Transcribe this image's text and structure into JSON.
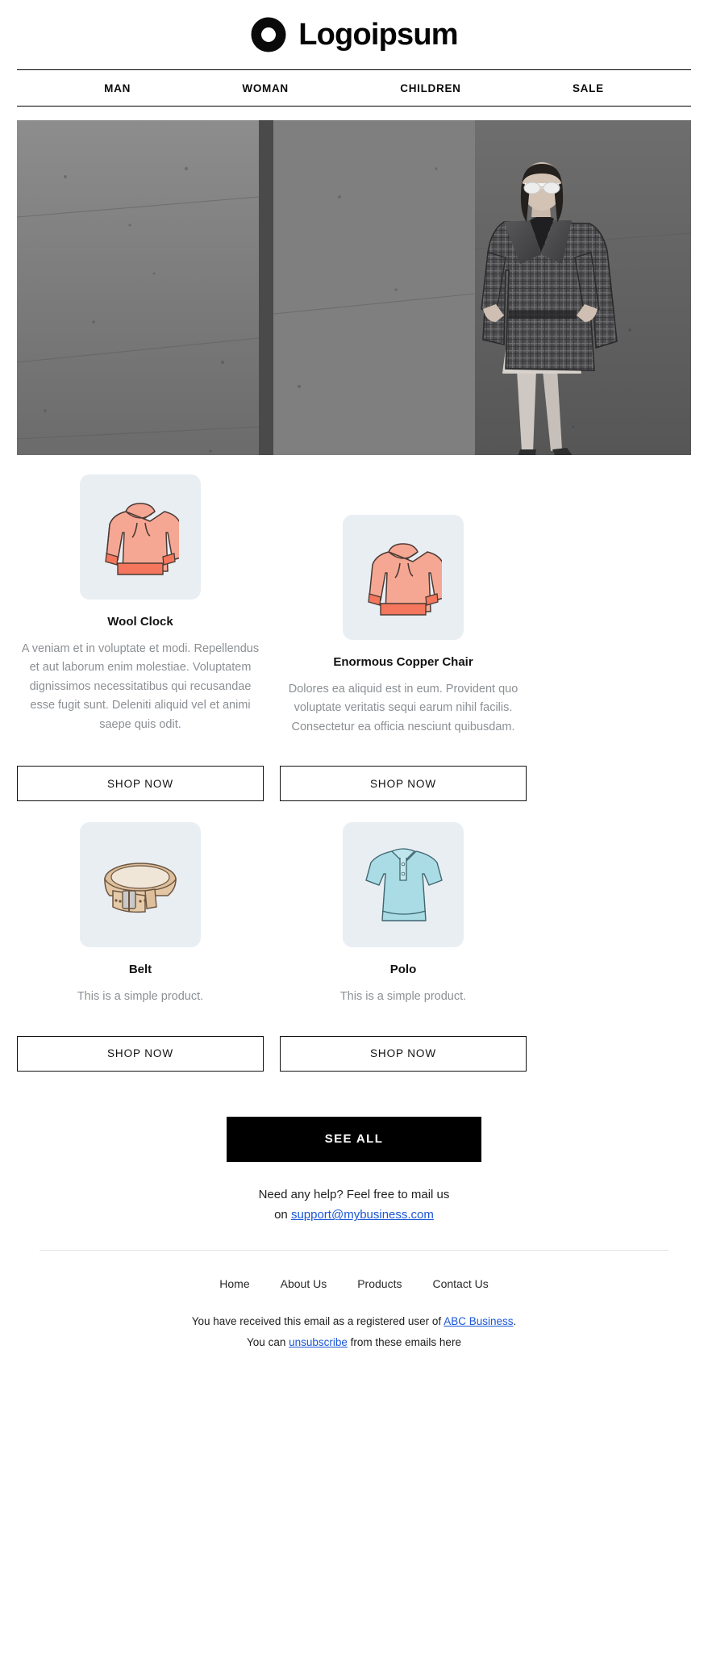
{
  "brand": {
    "name": "Logoipsum",
    "logo_icon": "logoipsum-circle-mark"
  },
  "nav": {
    "items": [
      {
        "label": "MAN"
      },
      {
        "label": "WOMAN"
      },
      {
        "label": "CHILDREN"
      },
      {
        "label": "SALE"
      }
    ]
  },
  "hero": {
    "alt": "woman-in-plaid-coat-black-and-white-photo"
  },
  "products": [
    {
      "title": "Wool Clock",
      "description": "A veniam et in voluptate et modi. Repellendus et aut laborum enim molestiae. Voluptatem dignissimos necessitatibus qui recusandae esse fugit sunt. Deleniti aliquid vel et animi saepe quis odit.",
      "button": "SHOP NOW",
      "image_icon": "pink-hoodie-illustration"
    },
    {
      "title": "Enormous Copper Chair",
      "description": "Dolores ea aliquid est in eum. Provident quo voluptate veritatis sequi earum nihil facilis. Consectetur ea officia nesciunt quibusdam.",
      "button": "SHOP NOW",
      "image_icon": "pink-hoodie-illustration"
    },
    {
      "title": "Belt",
      "description": "This is a simple product.",
      "button": "SHOP NOW",
      "image_icon": "tan-leather-belt-illustration"
    },
    {
      "title": "Polo",
      "description": "This is a simple product.",
      "button": "SHOP NOW",
      "image_icon": "light-blue-polo-shirt-illustration"
    }
  ],
  "cta": {
    "label": "SEE ALL"
  },
  "help": {
    "line1": "Need any help? Feel free to mail us",
    "line2_prefix": "on ",
    "email": "support@mybusiness.com"
  },
  "footer": {
    "links": [
      {
        "label": "Home"
      },
      {
        "label": "About Us"
      },
      {
        "label": "Products"
      },
      {
        "label": "Contact Us"
      }
    ],
    "legal_line1_prefix": "You have received this email as a registered user of ",
    "legal_line1_link": "ABC Business",
    "legal_line1_suffix": ".",
    "legal_line2_prefix": "You can ",
    "legal_line2_link": "unsubscribe",
    "legal_line2_suffix": " from these emails here"
  },
  "colors": {
    "accent_link": "#1a56d6",
    "thumb_bg": "#e9eef3",
    "cta_bg": "#000000",
    "hoodie": "#f4a18b",
    "belt": "#d8b48d",
    "polo": "#a9dce4"
  }
}
